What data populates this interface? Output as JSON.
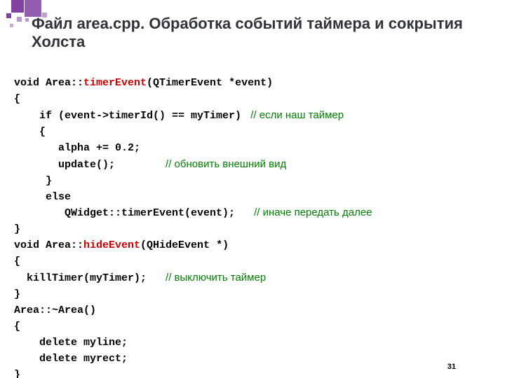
{
  "slide": {
    "title": "Файл area.cpp. Обработка событий таймера и сокрытия Холста",
    "page_number": "31"
  },
  "code": {
    "l01a": "void Area::",
    "l01b": "timerEvent",
    "l01c": "(QTimerEvent *event)",
    "l02": "{",
    "l03a": "    if (event->timerId() == myTimer) ",
    "l03c": " // если наш таймер",
    "l04": "    {",
    "l05": "       alpha += 0.2;",
    "l06a": "       update();        ",
    "l06c": "// обновить внешний вид",
    "l07": "     }",
    "l08": "     else",
    "l09a": "        QWidget::timerEvent(event);   ",
    "l09c": "// иначе передать далее",
    "l10": "}",
    "l11a": "void Area::",
    "l11b": "hideEvent",
    "l11c": "(QHideEvent *)",
    "l12": "{",
    "l13a": "  killTimer(myTimer);   ",
    "l13c": "// выключить таймер",
    "l14": "}",
    "l15": "Area::~Area()",
    "l16": "{",
    "l17": "    delete myline;",
    "l18": "    delete myrect;",
    "l19": "}"
  }
}
